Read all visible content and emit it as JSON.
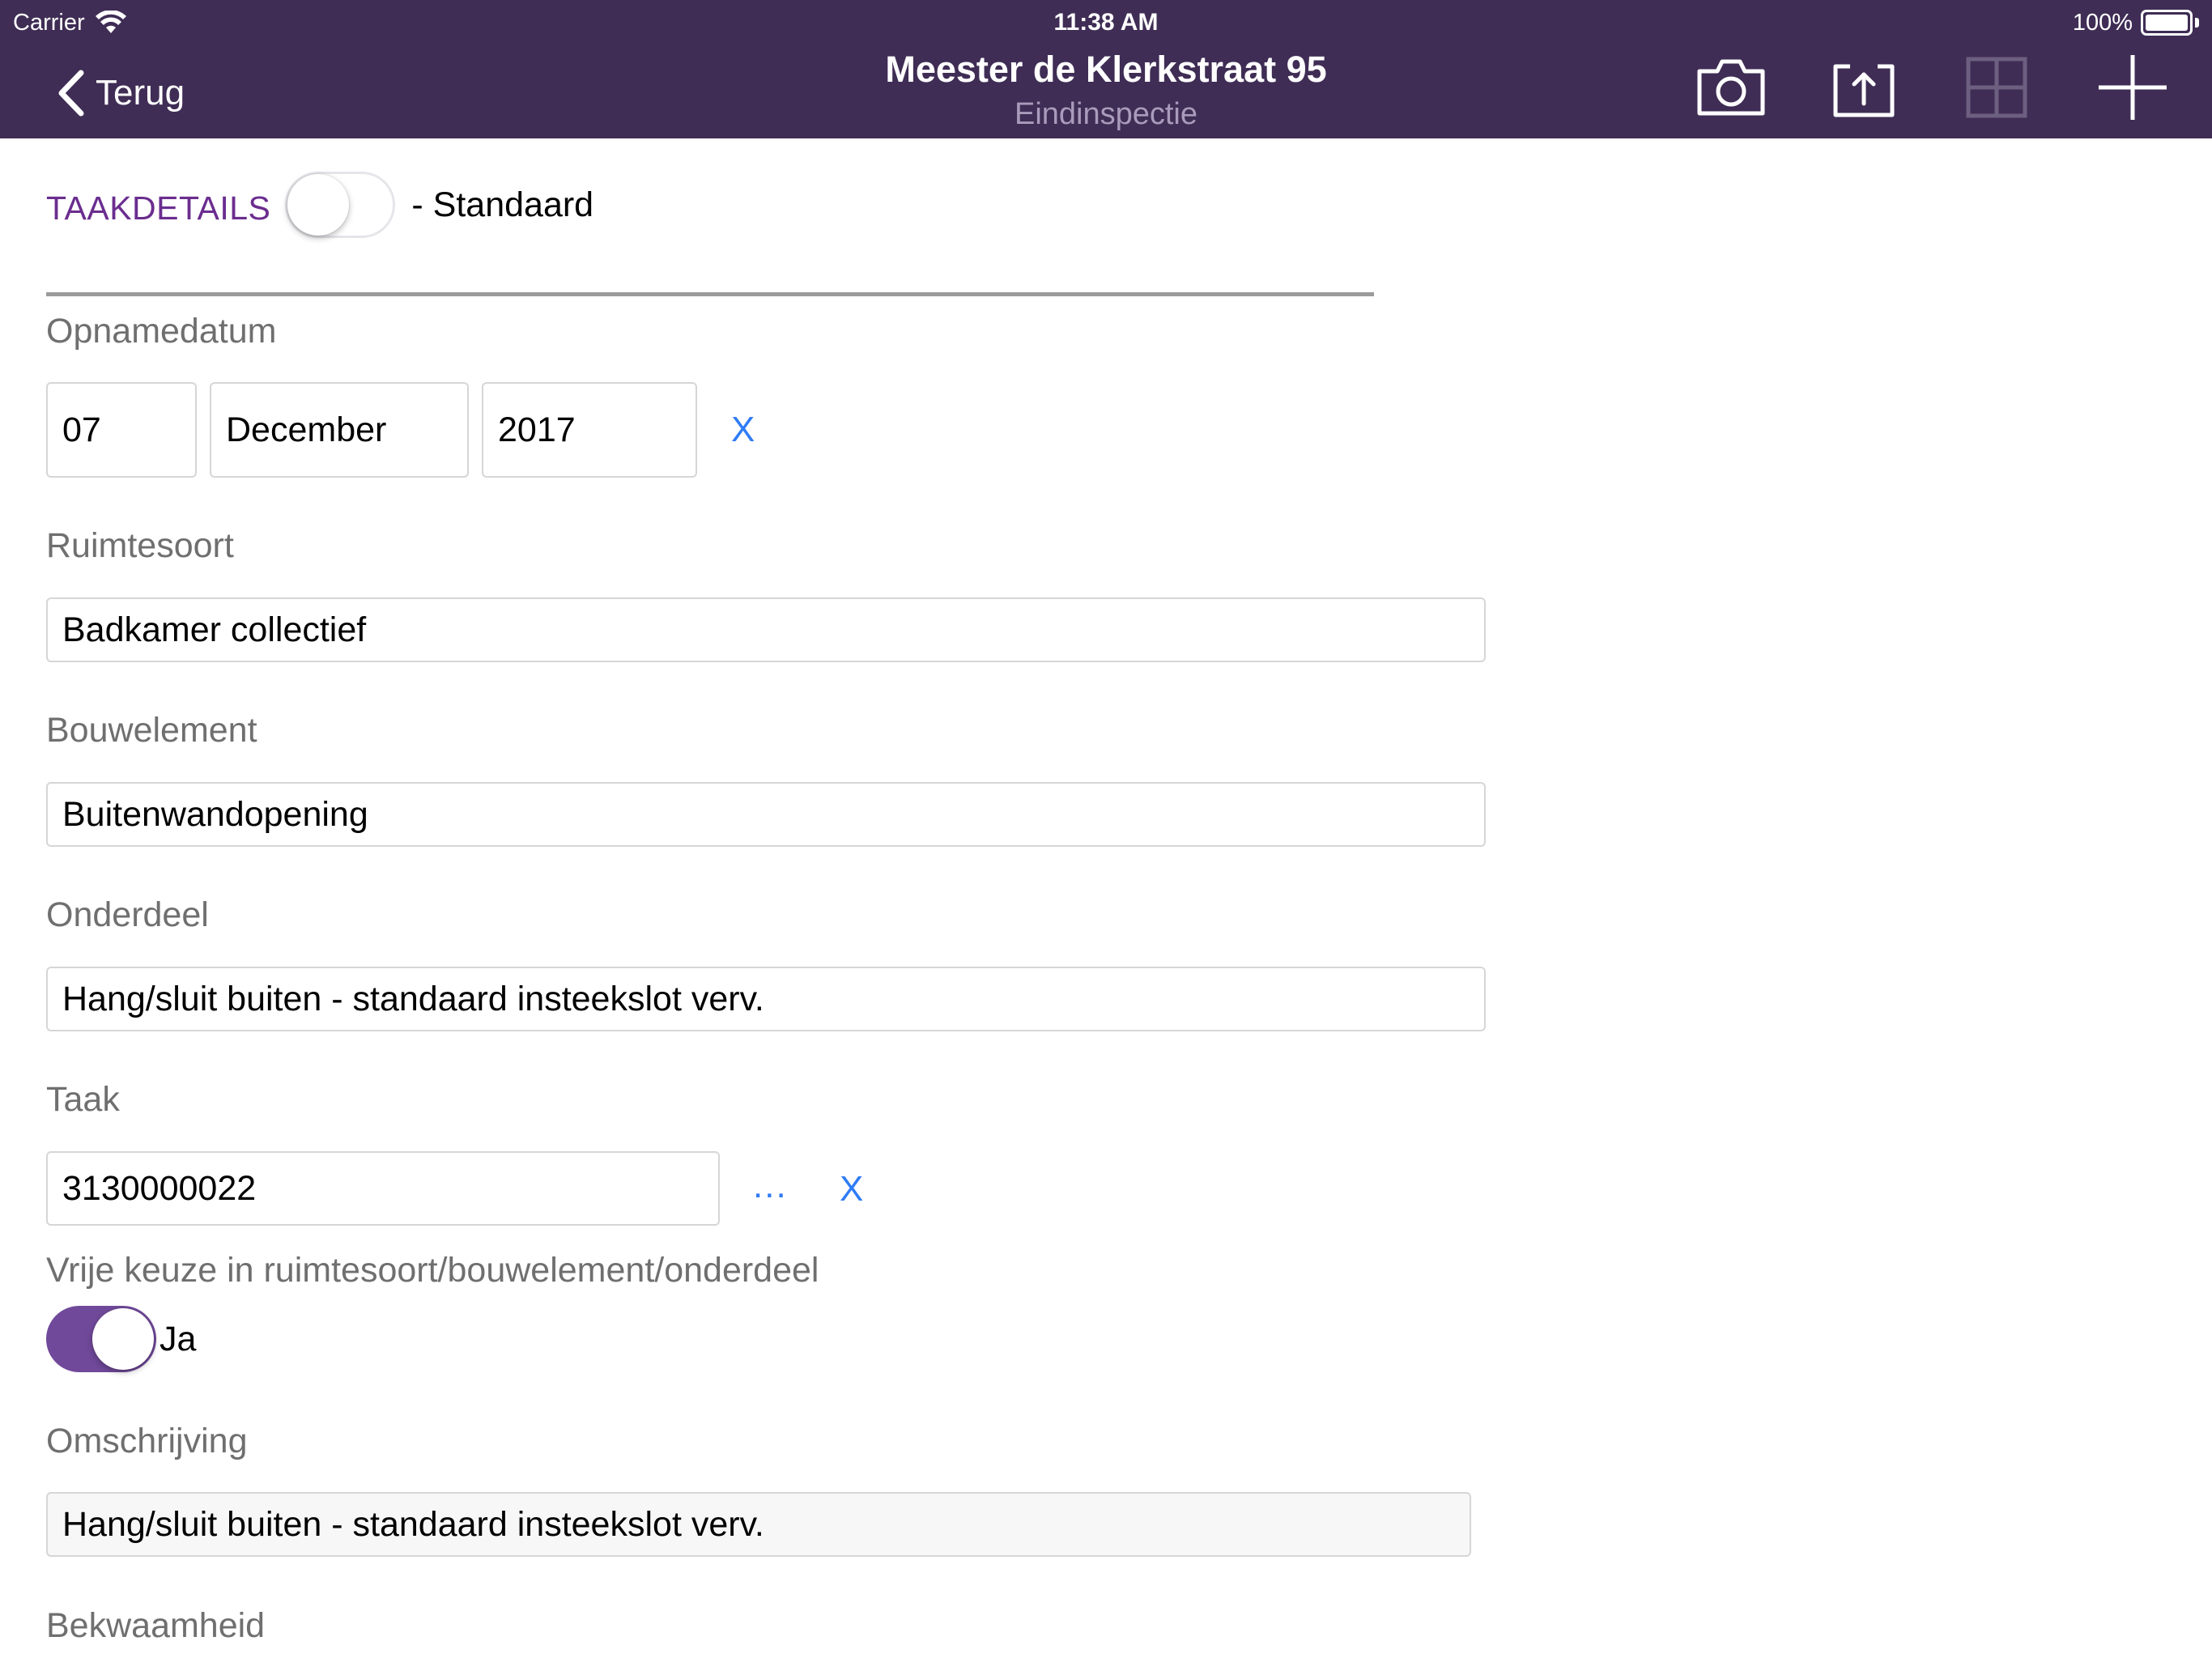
{
  "status_bar": {
    "carrier": "Carrier",
    "time": "11:38 AM",
    "battery": "100%"
  },
  "nav": {
    "back_label": "Terug",
    "title": "Meester de Klerkstraat 95",
    "subtitle": "Eindinspectie",
    "icons": [
      "camera-icon",
      "upload-icon",
      "grid-icon",
      "add-icon"
    ]
  },
  "section": {
    "title": "TAAKDETAILS",
    "toggle_on": false,
    "suffix": "- Standaard"
  },
  "opnamedatum": {
    "label": "Opnamedatum",
    "day": "07",
    "month": "December",
    "year": "2017",
    "clear": "X"
  },
  "ruimtesoort": {
    "label": "Ruimtesoort",
    "value": "Badkamer collectief"
  },
  "bouwelement": {
    "label": "Bouwelement",
    "value": "Buitenwandopening"
  },
  "onderdeel": {
    "label": "Onderdeel",
    "value": "Hang/sluit buiten - standaard insteekslot verv."
  },
  "taak": {
    "label": "Taak",
    "value": "3130000022",
    "more": "...",
    "clear": "X"
  },
  "vrije_keuze": {
    "label": "Vrije keuze in ruimtesoort/bouwelement/onderdeel",
    "toggle_on": true,
    "toggle_label": "Ja"
  },
  "omschrijving": {
    "label": "Omschrijving",
    "value": "Hang/sluit buiten - standaard insteekslot verv."
  },
  "bekwaamheid": {
    "label": "Bekwaamheid"
  },
  "colors": {
    "nav_background": "#3f2d55",
    "accent": "#70499a",
    "section_title": "#6b2d8f",
    "link": "#2f7cf6"
  }
}
